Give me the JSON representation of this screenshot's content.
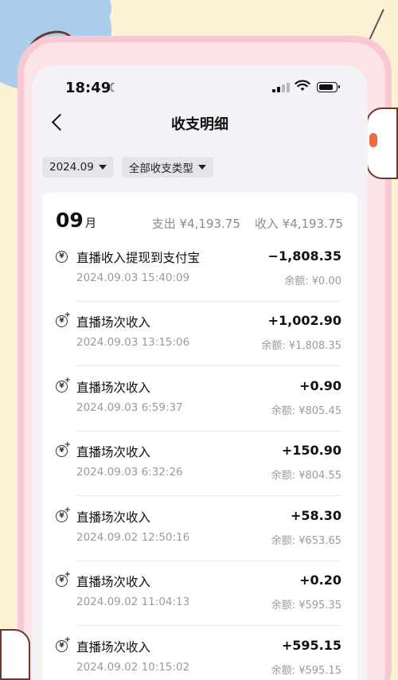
{
  "status": {
    "time": "18:49"
  },
  "nav": {
    "title": "收支明细"
  },
  "filters": {
    "month": "2024.09",
    "type": "全部收支类型"
  },
  "summary": {
    "month_num": "09",
    "month_unit": "月",
    "expense": "支出 ¥4,193.75",
    "income": "收入 ¥4,193.75"
  },
  "transactions": [
    {
      "name": "直播收入提现到支付宝",
      "date": "2024.09.03 15:40:09",
      "amount": "−1,808.35",
      "balance": "余额: ¥0.00",
      "icon": "withdraw-icon"
    },
    {
      "name": "直播场次收入",
      "date": "2024.09.03 13:15:06",
      "amount": "+1,002.90",
      "balance": "余额: ¥1,808.35",
      "icon": "income-icon"
    },
    {
      "name": "直播场次收入",
      "date": "2024.09.03 6:59:37",
      "amount": "+0.90",
      "balance": "余额: ¥805.45",
      "icon": "income-icon"
    },
    {
      "name": "直播场次收入",
      "date": "2024.09.03 6:32:26",
      "amount": "+150.90",
      "balance": "余额: ¥804.55",
      "icon": "income-icon"
    },
    {
      "name": "直播场次收入",
      "date": "2024.09.02 12:50:16",
      "amount": "+58.30",
      "balance": "余额: ¥653.65",
      "icon": "income-icon"
    },
    {
      "name": "直播场次收入",
      "date": "2024.09.02 11:04:13",
      "amount": "+0.20",
      "balance": "余额: ¥595.35",
      "icon": "income-icon"
    },
    {
      "name": "直播场次收入",
      "date": "2024.09.02 10:15:02",
      "amount": "+595.15",
      "balance": "余额: ¥595.15",
      "icon": "income-icon"
    }
  ]
}
